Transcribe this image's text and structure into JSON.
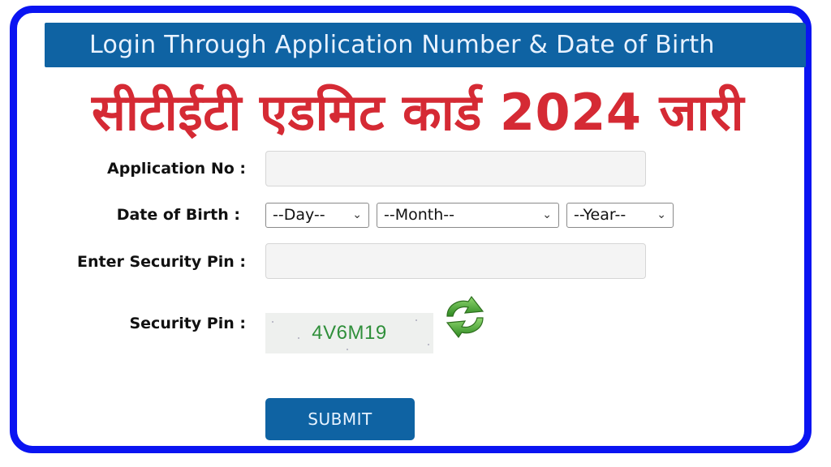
{
  "banner": {
    "title": "Login Through Application Number & Date of Birth"
  },
  "headline": {
    "text": "सीटीईटी एडमिट कार्ड 2024 जारी"
  },
  "form": {
    "application_no": {
      "label": "Application No :",
      "value": "",
      "placeholder": ""
    },
    "dob": {
      "label": "Date of Birth :",
      "day": {
        "selected": "--Day--"
      },
      "month": {
        "selected": "--Month--"
      },
      "year": {
        "selected": "--Year--"
      },
      "chevron": "⌄"
    },
    "enter_security_pin": {
      "label": "Enter Security Pin :",
      "value": "",
      "placeholder": ""
    },
    "security_pin": {
      "label": "Security Pin :",
      "captcha_text": "4V6M19",
      "refresh_icon": "refresh-icon"
    },
    "submit_label": "SUBMIT"
  },
  "colors": {
    "frame_border": "#0a14f2",
    "banner_bg": "#0f63a3",
    "headline": "#d52a34",
    "captcha_text": "#2f8f3a",
    "button_bg": "#0f63a3"
  }
}
